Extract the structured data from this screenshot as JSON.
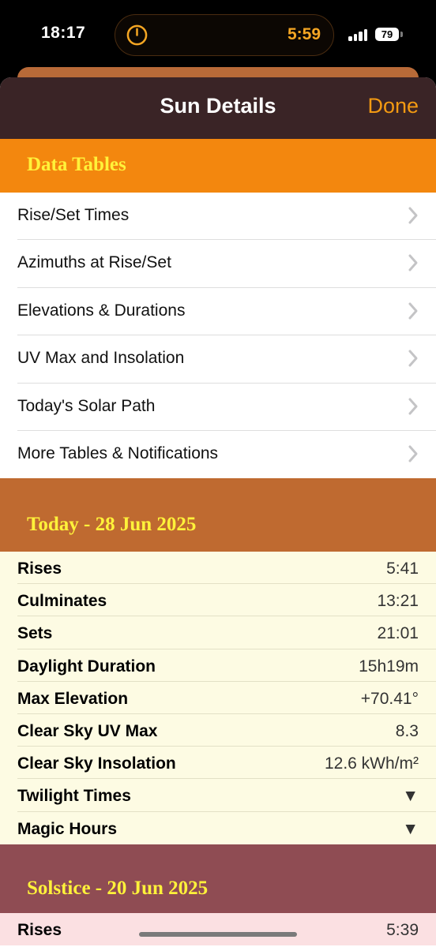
{
  "status_bar": {
    "time": "18:17",
    "live_activity_countdown": "5:59",
    "battery": "79"
  },
  "nav": {
    "title": "Sun Details",
    "done_label": "Done"
  },
  "data_tables": {
    "title": "Data Tables",
    "items": [
      {
        "label": "Rise/Set Times"
      },
      {
        "label": "Azimuths at Rise/Set"
      },
      {
        "label": "Elevations & Durations"
      },
      {
        "label": "UV Max and Insolation"
      },
      {
        "label": "Today's Solar Path"
      },
      {
        "label": "More Tables & Notifications"
      }
    ]
  },
  "today": {
    "title": "Today - 28 Jun 2025",
    "rows": [
      {
        "label": "Rises",
        "value": "5:41"
      },
      {
        "label": "Culminates",
        "value": "13:21"
      },
      {
        "label": "Sets",
        "value": "21:01"
      },
      {
        "label": "Daylight Duration",
        "value": "15h19m"
      },
      {
        "label": "Max Elevation",
        "value": "+70.41°"
      },
      {
        "label": "Clear Sky UV Max",
        "value": "8.3"
      },
      {
        "label": "Clear Sky Insolation",
        "value": "12.6 kWh/m²"
      },
      {
        "label": "Twilight Times",
        "value": "▼"
      },
      {
        "label": "Magic Hours",
        "value": "▼"
      }
    ]
  },
  "solstice": {
    "title": "Solstice - 20 Jun 2025",
    "rows": [
      {
        "label": "Rises",
        "value": "5:39"
      }
    ]
  },
  "colors": {
    "accent": "#f39a12",
    "nav_bg": "#3a2426",
    "tables_header": "#f3870e",
    "today_header": "#bf6a30",
    "solstice_header": "#8f4c53",
    "section_title": "#fff23a"
  }
}
